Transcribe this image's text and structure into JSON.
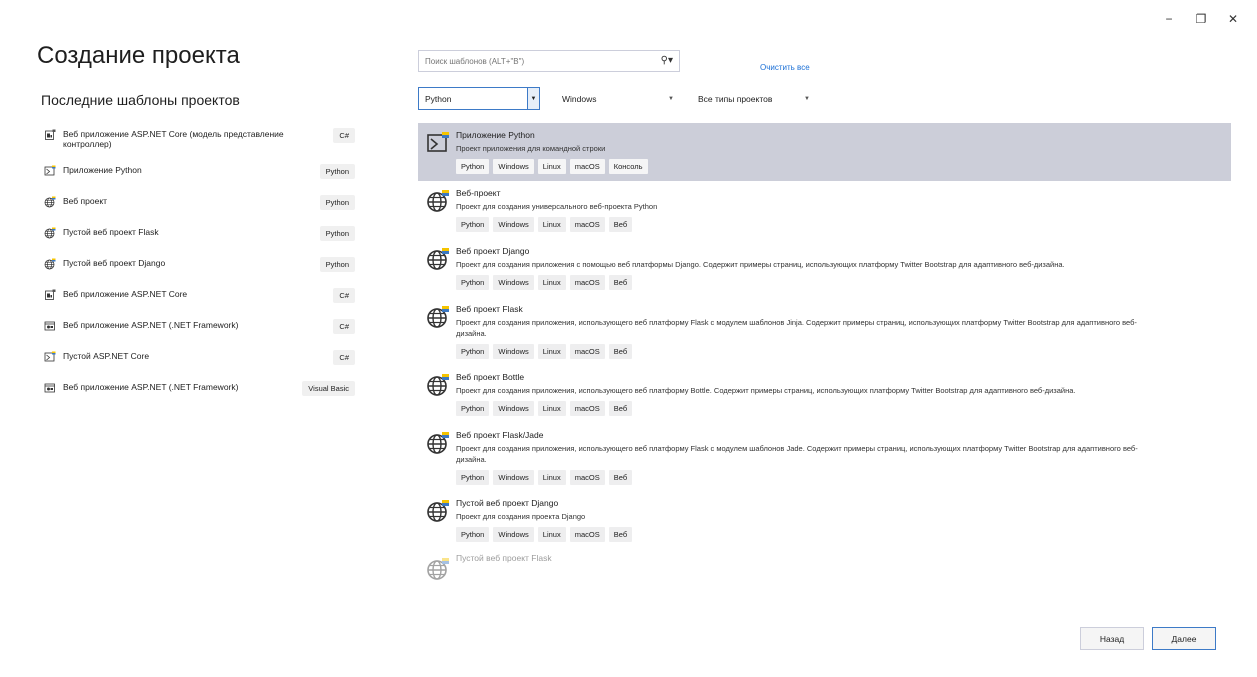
{
  "window": {
    "minimize": "−",
    "restore": "❐",
    "close": "✕"
  },
  "page_title": "Создание проекта",
  "recent": {
    "title": "Последние шаблоны проектов",
    "items": [
      {
        "label": "Веб приложение ASP.NET Core (модель представление контроллер)",
        "lang": "C#",
        "icon": "aspnet-icon"
      },
      {
        "label": "Приложение Python",
        "lang": "Python",
        "icon": "python-console-icon"
      },
      {
        "label": "Веб проект",
        "lang": "Python",
        "icon": "globe-icon"
      },
      {
        "label": "Пустой веб проект Flask",
        "lang": "Python",
        "icon": "globe-icon"
      },
      {
        "label": "Пустой веб проект Django",
        "lang": "Python",
        "icon": "globe-icon"
      },
      {
        "label": "Веб приложение ASP.NET Core",
        "lang": "C#",
        "icon": "aspnet-icon"
      },
      {
        "label": "Веб приложение ASP.NET (.NET Framework)",
        "lang": "C#",
        "icon": "aspnet-framework-icon"
      },
      {
        "label": "Пустой ASP.NET Core",
        "lang": "C#",
        "icon": "python-console-icon"
      },
      {
        "label": "Веб приложение ASP.NET (.NET Framework)",
        "lang": "Visual Basic",
        "icon": "aspnet-framework-icon"
      }
    ]
  },
  "search": {
    "placeholder": "Поиск шаблонов (ALT+\"В\")",
    "icon": "search-icon"
  },
  "clear_all": "Очистить все",
  "filters": {
    "language": "Python",
    "platform": "Windows",
    "type": "Все типы проектов"
  },
  "templates": [
    {
      "name": "Приложение Python",
      "desc": "Проект приложения для командной строки",
      "tags": [
        "Python",
        "Windows",
        "Linux",
        "macOS",
        "Консоль"
      ],
      "selected": true,
      "icon": "python-console-icon"
    },
    {
      "name": "Веб-проект",
      "desc": "Проект для создания универсального веб-проекта Python",
      "tags": [
        "Python",
        "Windows",
        "Linux",
        "macOS",
        "Веб"
      ],
      "icon": "globe-icon"
    },
    {
      "name": "Веб проект Django",
      "desc": "Проект для создания приложения с помощью веб платформы Django. Содержит примеры страниц, использующих платформу Twitter Bootstrap для адаптивного веб-дизайна.",
      "tags": [
        "Python",
        "Windows",
        "Linux",
        "macOS",
        "Веб"
      ],
      "icon": "globe-icon"
    },
    {
      "name": "Веб проект Flask",
      "desc": "Проект для создания приложения, использующего веб платформу Flask с модулем шаблонов Jinja. Содержит примеры страниц, использующих платформу Twitter Bootstrap для адаптивного веб-дизайна.",
      "tags": [
        "Python",
        "Windows",
        "Linux",
        "macOS",
        "Веб"
      ],
      "icon": "globe-icon"
    },
    {
      "name": "Веб проект Bottle",
      "desc": "Проект для создания приложения, использующего веб платформу Bottle. Содержит примеры страниц, использующих платформу Twitter Bootstrap для адаптивного веб-дизайна.",
      "tags": [
        "Python",
        "Windows",
        "Linux",
        "macOS",
        "Веб"
      ],
      "icon": "globe-icon"
    },
    {
      "name": "Веб проект Flask/Jade",
      "desc": "Проект для создания приложения, использующего веб платформу Flask с модулем шаблонов Jade. Содержит примеры страниц, использующих платформу Twitter Bootstrap для адаптивного веб-дизайна.",
      "tags": [
        "Python",
        "Windows",
        "Linux",
        "macOS",
        "Веб"
      ],
      "icon": "globe-icon"
    },
    {
      "name": "Пустой веб проект Django",
      "desc": "Проект для создания проекта Django",
      "tags": [
        "Python",
        "Windows",
        "Linux",
        "macOS",
        "Веб"
      ],
      "icon": "globe-icon"
    },
    {
      "name": "Пустой веб проект Flask",
      "desc": "",
      "tags": [],
      "faded": true,
      "icon": "globe-icon"
    }
  ],
  "buttons": {
    "back": "Назад",
    "next": "Далее"
  }
}
